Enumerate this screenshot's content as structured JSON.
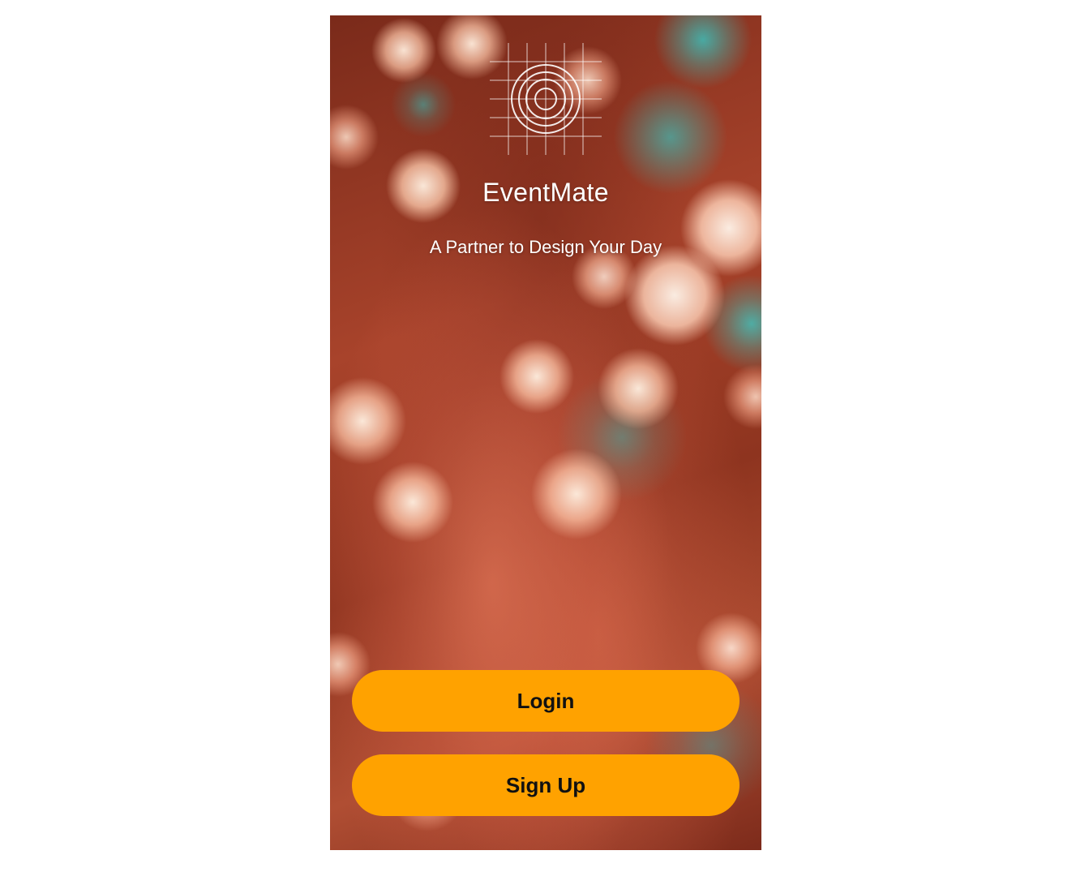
{
  "app": {
    "title": "EventMate",
    "tagline": "A Partner to Design Your Day",
    "logo_icon": "grid-target-icon"
  },
  "actions": {
    "login_label": "Login",
    "signup_label": "Sign Up"
  },
  "colors": {
    "button_background": "#ffa200",
    "button_text": "#111111",
    "text": "#ffffff"
  }
}
